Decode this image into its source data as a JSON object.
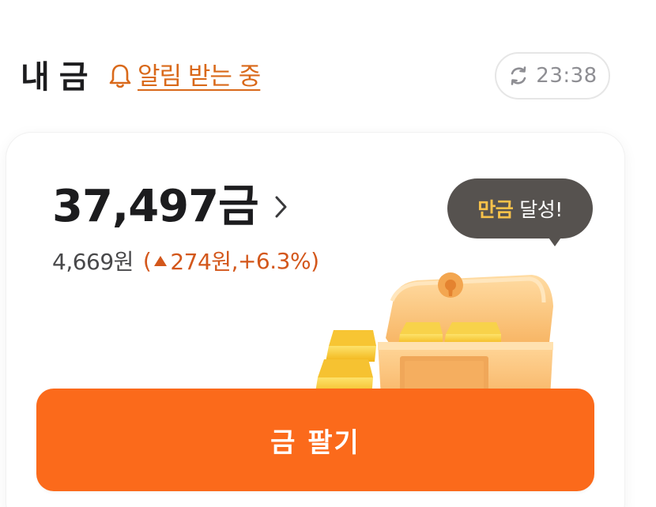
{
  "header": {
    "title": "내 금",
    "alert_label": "알림 받는 중",
    "refresh_time": "23:38"
  },
  "holding": {
    "amount": "37,497금",
    "value": "4,669원",
    "change_open": "(",
    "change_amount": "274원,",
    "change_percent": "+6.3%",
    "change_close": ")"
  },
  "bubble": {
    "highlight": "만금",
    "text": "달성!"
  },
  "actions": {
    "sell_label": "금 팔기"
  },
  "colors": {
    "accent": "#fb6a1b",
    "alert": "#d9691a",
    "change": "#d3571b",
    "bubble_bg": "#56524f",
    "bubble_highlight": "#f8c24a"
  },
  "icons": {
    "alert": "bell-icon",
    "refresh": "refresh-icon",
    "balance_chevron": "chevron-right-icon",
    "change_direction": "up-triangle-icon",
    "illustration": "gold-treasure-chest"
  }
}
